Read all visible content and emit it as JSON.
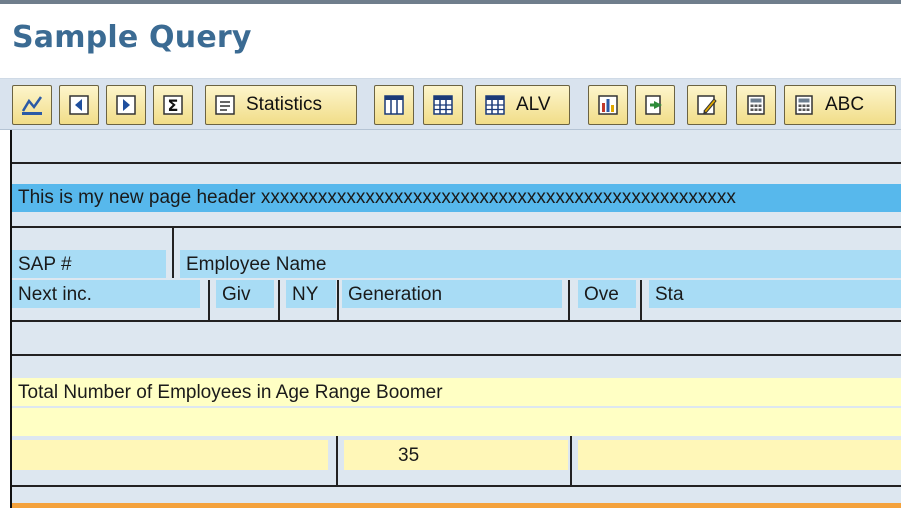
{
  "page": {
    "title": "Sample Query"
  },
  "toolbar": {
    "statistics_label": "Statistics",
    "alv_label": "ALV",
    "abc_label": "ABC"
  },
  "report": {
    "page_header": "This is my new page header xxxxxxxxxxxxxxxxxxxxxxxxxxxxxxxxxxxxxxxxxxxxxxxxxx",
    "columns_row1": [
      "SAP #",
      "Employee Name"
    ],
    "columns_row2": [
      "Next inc.",
      "Giv",
      "NY",
      "Generation",
      "Ove",
      "Sta"
    ],
    "group_total_label": "Total Number of Employees in Age Range Boomer",
    "group_total_value": "35"
  },
  "colors": {
    "title": "#3b6b93",
    "header_blue": "#57b8ec",
    "column_blue": "#a8dcf5",
    "total_yellow": "#ffffc4",
    "accent_orange": "#f4a23c"
  }
}
